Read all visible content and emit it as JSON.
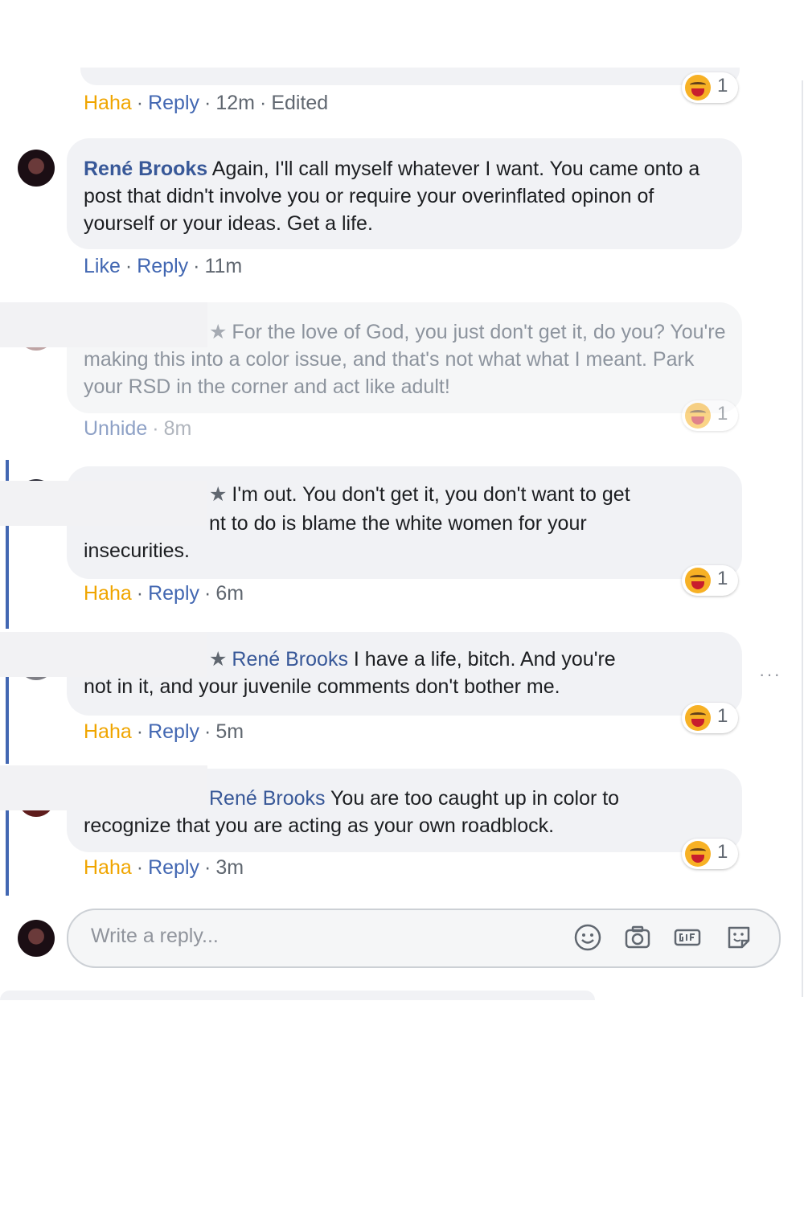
{
  "comments": [
    {
      "actions": {
        "reaction": "Haha",
        "reply": "Reply",
        "time": "12m",
        "edited": "Edited"
      },
      "reactions": {
        "icon": "haha-emoji",
        "count": "1"
      }
    },
    {
      "author": "René Brooks",
      "text": "Again, I'll call myself whatever I want. You came onto a post that didn't involve you or require your overinflated opinon of yourself or your ideas. Get a life.",
      "actions": {
        "reaction": "Like",
        "reply": "Reply",
        "time": "11m"
      }
    },
    {
      "text": "For the love of God, you just don't get it, do you? You're making this into a color issue, and that's not what what I meant. Park your RSD in the corner and act like adult!",
      "actions": {
        "unhide": "Unhide",
        "time": "8m"
      },
      "reactions": {
        "icon": "haha-emoji",
        "count": "1"
      }
    },
    {
      "text_line1": "I'm out. You don't get it, you don't want to get",
      "text_line2": "nt to do is blame the white women for your",
      "text_line3": "insecurities.",
      "actions": {
        "reaction": "Haha",
        "reply": "Reply",
        "time": "6m"
      },
      "reactions": {
        "icon": "haha-emoji",
        "count": "1"
      }
    },
    {
      "mention": "René Brooks",
      "text_line1": "I have a life, bitch. And you're",
      "text_line2": "not in it, and your juvenile comments don't bother me.",
      "actions": {
        "reaction": "Haha",
        "reply": "Reply",
        "time": "5m"
      },
      "reactions": {
        "icon": "haha-emoji",
        "count": "1"
      }
    },
    {
      "mention": "René Brooks",
      "text_line1": "You are too caught up in color to",
      "text_line2": "recognize that you are acting as your own roadblock.",
      "actions": {
        "reaction": "Haha",
        "reply": "Reply",
        "time": "3m"
      },
      "reactions": {
        "icon": "haha-emoji",
        "count": "1"
      }
    }
  ],
  "more_options": "···",
  "reply_box": {
    "placeholder": "Write a reply..."
  },
  "colors": {
    "link": "#4267b2",
    "haha": "#f0a500",
    "bubble": "#f1f2f5",
    "thread_line": "#4267b2"
  }
}
